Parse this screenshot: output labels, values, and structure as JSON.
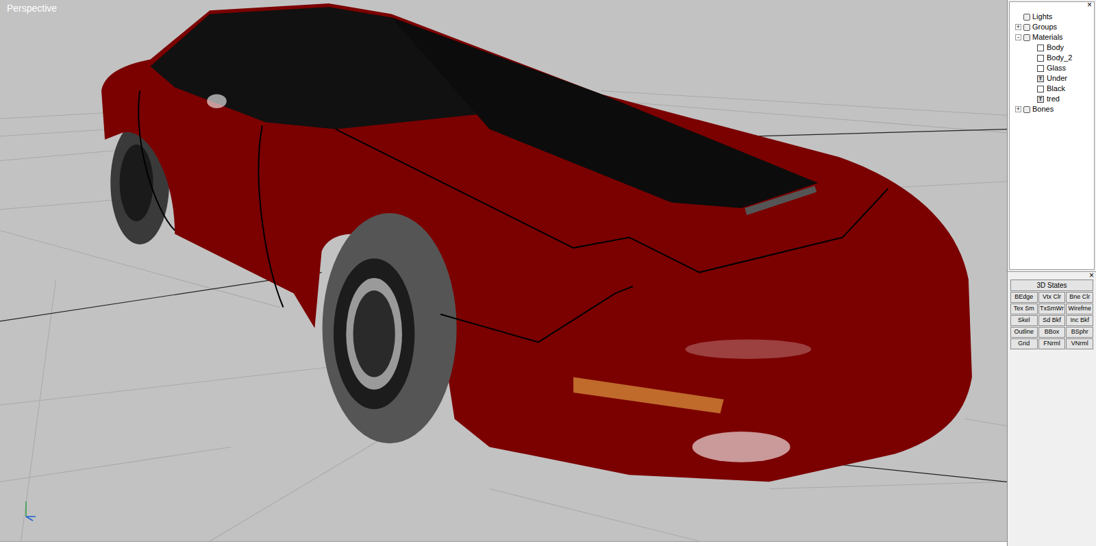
{
  "viewport": {
    "title": "Perspective"
  },
  "tree_panel": {
    "close": "×"
  },
  "tree": [
    {
      "label": "Lights",
      "expander": "",
      "expanded": false,
      "children": []
    },
    {
      "label": "Groups",
      "expander": "+",
      "expanded": false,
      "children": []
    },
    {
      "label": "Materials",
      "expander": "-",
      "expanded": true,
      "children": [
        {
          "label": "Body",
          "kind": "plain",
          "badge": ""
        },
        {
          "label": "Body_2",
          "kind": "plain",
          "badge": ""
        },
        {
          "label": "Glass",
          "kind": "plain",
          "badge": ""
        },
        {
          "label": "Under",
          "kind": "textured",
          "badge": "T"
        },
        {
          "label": "Black",
          "kind": "plain",
          "badge": ""
        },
        {
          "label": "tred",
          "kind": "textured",
          "badge": "T"
        }
      ]
    },
    {
      "label": "Bones",
      "expander": "+",
      "expanded": false,
      "children": []
    }
  ],
  "states_panel": {
    "close": "×",
    "title": "3D States",
    "buttons": [
      "BEdge",
      "Vtx Clr",
      "Bne Clr",
      "Tex Sm",
      "TxSmWr",
      "Wirefme",
      "Skel",
      "Sd Bkf",
      "Inc Bkf",
      "Outline",
      "BBox",
      "BSphr",
      "Grid",
      "FNrml",
      "VNrml"
    ]
  }
}
